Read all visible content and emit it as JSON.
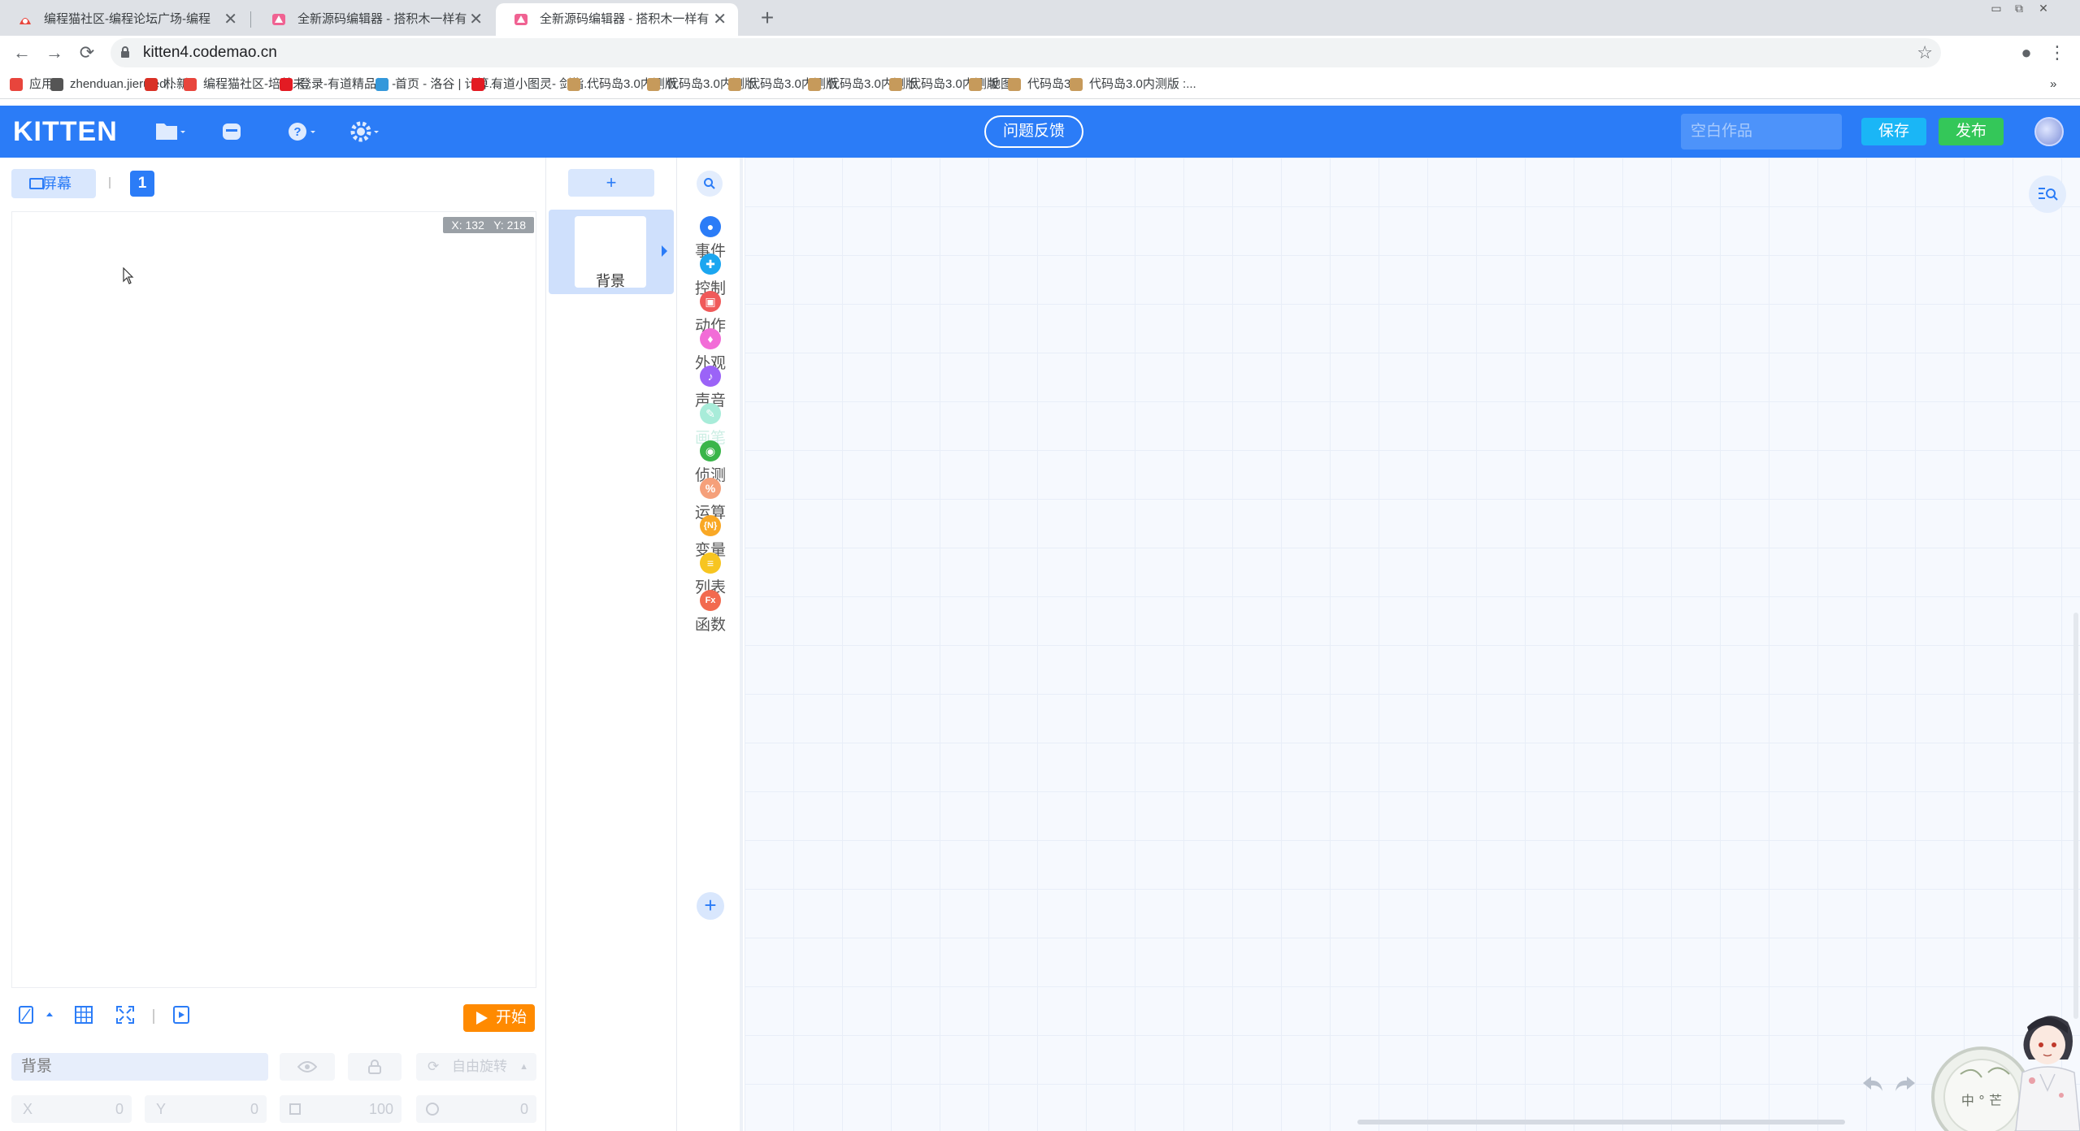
{
  "browser": {
    "tabs": [
      {
        "title": "编程猫社区-编程论坛广场-编程"
      },
      {
        "title": "全新源码编辑器 - 搭积木一样有"
      },
      {
        "title": "全新源码编辑器 - 搭积木一样有"
      }
    ],
    "new_tab": "+",
    "window_controls": [
      "▭",
      "⧉",
      "✕"
    ],
    "url": "kitten4.codemao.cn",
    "nav": {
      "back": "←",
      "forward": "→",
      "reload": "⟳",
      "star": "☆",
      "profile": "●",
      "menu": "⋮"
    },
    "bookmarks": [
      {
        "label": "应用",
        "color": "#e8453c"
      },
      {
        "label": "zhenduan.jieruied...",
        "color": "#555555"
      },
      {
        "label": "朴新",
        "color": "#d93025"
      },
      {
        "label": "编程猫社区-培养未...",
        "color": "#e8453c"
      },
      {
        "label": "登录-有道精品课 -...",
        "color": "#e31b23"
      },
      {
        "label": "首页 - 洛谷 | 计算...",
        "color": "#3498db"
      },
      {
        "label": "有道小图灵- 剑指...",
        "color": "#e31b23"
      },
      {
        "label": "代码岛3.0内测版",
        "color": "#c69a5b"
      },
      {
        "label": "代码岛3.0内测版",
        "color": "#c69a5b"
      },
      {
        "label": "代码岛3.0内测版",
        "color": "#c69a5b"
      },
      {
        "label": "代码岛3.0内测版",
        "color": "#c69a5b"
      },
      {
        "label": "代码岛3.0内测版",
        "color": "#c69a5b"
      },
      {
        "label": "地图",
        "color": "#c69a5b"
      },
      {
        "label": "代码岛3.0",
        "color": "#c69a5b"
      },
      {
        "label": "代码岛3.0内测版 :...",
        "color": "#c69a5b"
      }
    ],
    "bookmarks_overflow": "»"
  },
  "header": {
    "logo": "KITTEN",
    "feedback_label": "问题反馈",
    "title_placeholder": "空白作品",
    "save_label": "保存",
    "publish_label": "发布",
    "accent": "#2b7cf7"
  },
  "stage": {
    "screen_label": "屏幕",
    "screen_number": "1",
    "coords": "X: 132   Y: 218",
    "start_label": "开始"
  },
  "props": {
    "sprite_name": "背景",
    "rotation_label": "自由旋转",
    "x_label": "X",
    "x_value": "0",
    "y_label": "Y",
    "y_value": "0",
    "size_value": "100",
    "direction_value": "0"
  },
  "sprites": {
    "add_label": "+",
    "background_label": "背景"
  },
  "categories": [
    {
      "label": "事件",
      "color": "#2b7cf7",
      "glyph": "●"
    },
    {
      "label": "控制",
      "color": "#1ba6f0",
      "glyph": "✚"
    },
    {
      "label": "动作",
      "color": "#f05a5a",
      "glyph": "▣"
    },
    {
      "label": "外观",
      "color": "#f26cd7",
      "glyph": "♦"
    },
    {
      "label": "声音",
      "color": "#9b63f7",
      "glyph": "♪"
    },
    {
      "label": "画笔",
      "color": "#a8ecd9",
      "glyph": "✎"
    },
    {
      "label": "侦测",
      "color": "#3ab54a",
      "glyph": "◉"
    },
    {
      "label": "运算",
      "color": "#f5a07a",
      "glyph": "%"
    },
    {
      "label": "变量",
      "color": "#f9a825",
      "glyph": "{N}"
    },
    {
      "label": "列表",
      "color": "#f7c520",
      "glyph": "≡"
    },
    {
      "label": "函数",
      "color": "#f26a4f",
      "glyph": "Fx"
    }
  ],
  "mascot_text": "中 ° 芒"
}
